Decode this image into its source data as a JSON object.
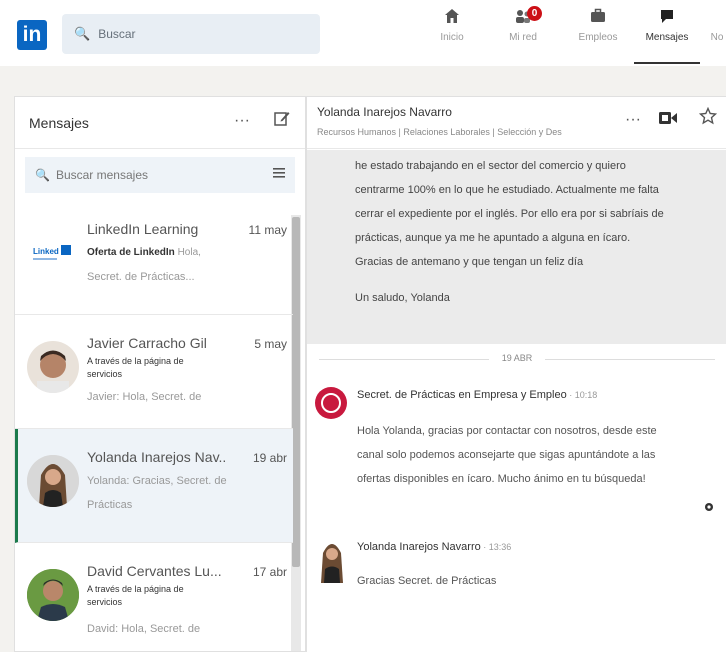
{
  "topbar": {
    "logo": "in",
    "search_placeholder": "Buscar",
    "nav": [
      {
        "label": "Inicio",
        "icon": "home-icon",
        "glyph": "⌂"
      },
      {
        "label": "Mi red",
        "icon": "people-icon",
        "glyph": "👥",
        "badge": "0"
      },
      {
        "label": "Empleos",
        "icon": "briefcase-icon",
        "glyph": "💼"
      },
      {
        "label": "Mensajes",
        "icon": "chat-icon",
        "glyph": "💬"
      },
      {
        "label": "No",
        "icon": "bell-icon",
        "glyph": ""
      }
    ]
  },
  "left": {
    "title": "Mensajes",
    "dots": "···",
    "search_placeholder": "Buscar mensajes",
    "conversations": [
      {
        "name": "LinkedIn Learning",
        "date": "11 may",
        "line1_bold": "Oferta de LinkedIn",
        "line1_muted": " Hola,",
        "line2": "Secret. de Prácticas..."
      },
      {
        "name": "Javier Carracho Gil",
        "date": "5 may",
        "line1": "A través de la página de servicios",
        "line2": "Javier: Hola, Secret. de"
      },
      {
        "name": "Yolanda Inarejos Nav...",
        "date": "19 abr",
        "line1": "Yolanda: Gracias, Secret. de",
        "line2": "Prácticas"
      },
      {
        "name": "David Cervantes Lu...",
        "date": "17 abr",
        "line1": "A través de la página de servicios",
        "line2": "David: Hola, Secret. de"
      }
    ]
  },
  "right": {
    "name": "Yolanda Inarejos Navarro",
    "subtitle": "Recursos Humanos | Relaciones Laborales | Selección y Des",
    "dots": "···",
    "quoted": "he estado trabajando en el sector del comercio y quiero centrarme 100% en lo que he estudiado. Actualmente me falta cerrar el expediente por el inglés. Por ello era por si sabríais de prácticas, aunque ya me he apuntado a alguna en ícaro. Gracias de antemano y que tengan un feliz día",
    "signature": "Un saludo, Yolanda",
    "date_divider": "19 ABR",
    "messages": [
      {
        "sender": "Secret. de Prácticas en Empresa y Empleo",
        "time": " · 10:18",
        "text": "Hola Yolanda, gracias por contactar con nosotros, desde este canal solo podemos aconsejarte que sigas apuntándote a las ofertas disponibles en ícaro. Mucho ánimo en tu búsqueda!"
      },
      {
        "sender": "Yolanda Inarejos Navarro",
        "time": " · 13:36",
        "text": "Gracias Secret. de Prácticas"
      }
    ]
  }
}
